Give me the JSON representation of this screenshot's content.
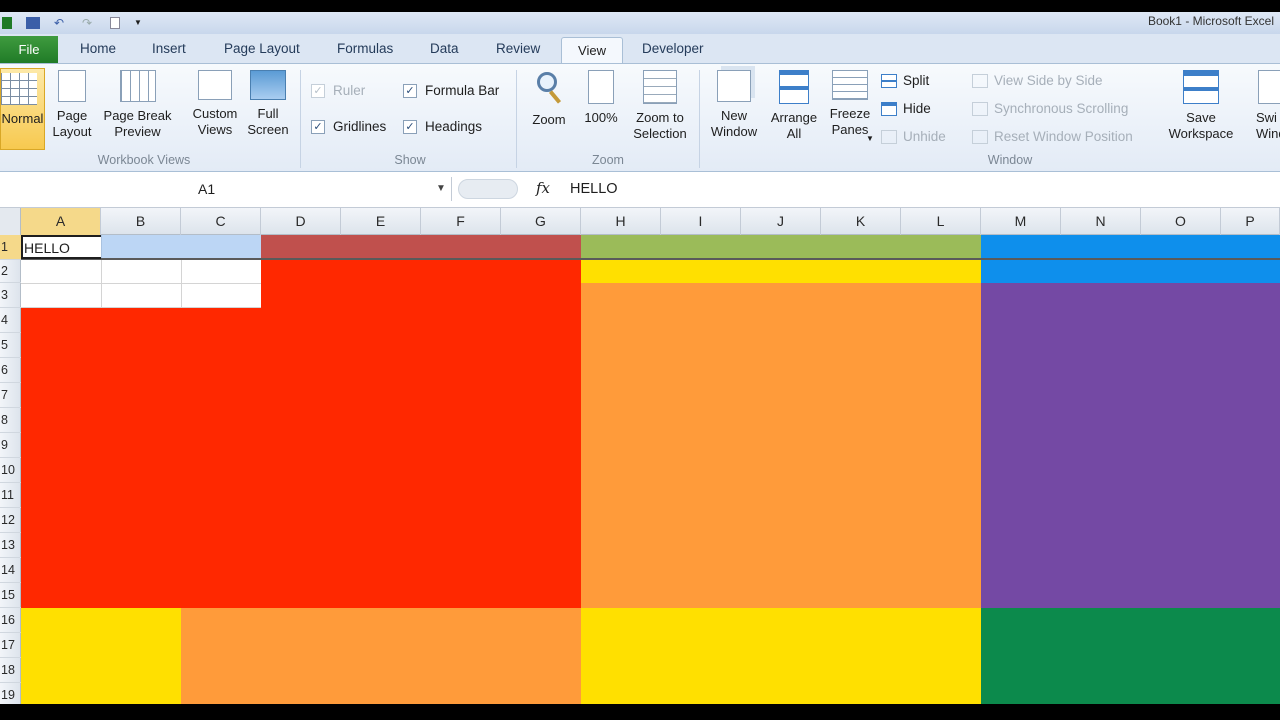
{
  "window": {
    "title": "Book1 - Microsoft Excel"
  },
  "tabs": [
    "File",
    "Home",
    "Insert",
    "Page Layout",
    "Formulas",
    "Data",
    "Review",
    "View",
    "Developer"
  ],
  "ribbon": {
    "workbook_views": {
      "label": "Workbook Views",
      "normal": "Normal",
      "page_layout": "Page\nLayout",
      "page_break_preview": "Page Break\nPreview",
      "custom_views": "Custom\nViews",
      "full_screen": "Full\nScreen"
    },
    "show": {
      "label": "Show",
      "ruler": {
        "label": "Ruler",
        "checked": true,
        "enabled": false
      },
      "formula_bar": {
        "label": "Formula Bar",
        "checked": true
      },
      "gridlines": {
        "label": "Gridlines",
        "checked": true
      },
      "headings": {
        "label": "Headings",
        "checked": true
      }
    },
    "zoom": {
      "label": "Zoom",
      "zoom": "Zoom",
      "hundred": "100%",
      "zoom_to_selection": "Zoom to\nSelection"
    },
    "window": {
      "label": "Window",
      "new_window": "New\nWindow",
      "arrange_all": "Arrange\nAll",
      "freeze_panes": "Freeze\nPanes",
      "split": "Split",
      "hide": "Hide",
      "unhide": "Unhide",
      "view_side_by_side": "View Side by Side",
      "synchronous_scrolling": "Synchronous Scrolling",
      "reset_window_position": "Reset Window Position",
      "save_workspace": "Save\nWorkspace",
      "switch_windows": "Swi\nWind"
    }
  },
  "formula_bar": {
    "name_box": "A1",
    "fx": "fx",
    "value": "HELLO"
  },
  "sheet": {
    "columns": [
      "A",
      "B",
      "C",
      "D",
      "E",
      "F",
      "G",
      "H",
      "I",
      "J",
      "K",
      "L",
      "M",
      "N",
      "O",
      "P"
    ],
    "rows": [
      "1",
      "2",
      "3",
      "4",
      "5",
      "6",
      "7",
      "8",
      "9",
      "10",
      "11",
      "12",
      "13",
      "14",
      "15",
      "16",
      "17",
      "18",
      "19"
    ],
    "a1_value": "HELLO",
    "colors": {
      "light_blue": "#bcd6f5",
      "dull_red": "#c0504d",
      "olive_green": "#9bbb59",
      "bright_blue": "#0e8fec",
      "red": "#ff2800",
      "yellow": "#ffe000",
      "orange": "#ff9b3a",
      "purple": "#7449a4",
      "green": "#0c8a4c"
    }
  }
}
